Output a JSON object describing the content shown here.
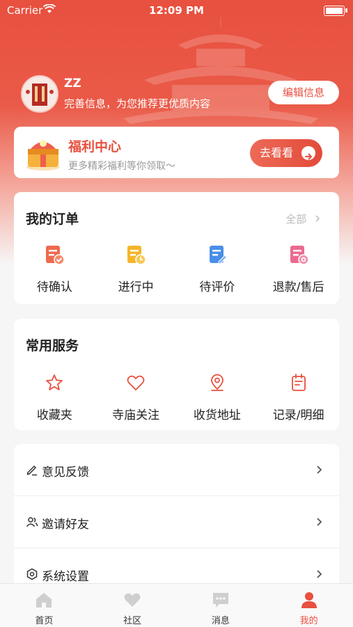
{
  "status_bar": {
    "carrier": "Carrier",
    "time": "12:09 PM"
  },
  "profile": {
    "username": "ZZ",
    "subtitle": "完善信息，为您推荐更优质内容",
    "edit_button": "编辑信息"
  },
  "welfare": {
    "title": "福利中心",
    "desc": "更多精彩福利等你领取～",
    "go_button": "去看看"
  },
  "orders": {
    "title": "我的订单",
    "all_label": "全部",
    "items": [
      {
        "label": "待确认",
        "icon": "pending-confirm-icon"
      },
      {
        "label": "进行中",
        "icon": "in-progress-icon"
      },
      {
        "label": "待评价",
        "icon": "to-review-icon"
      },
      {
        "label": "退款/售后",
        "icon": "refund-icon"
      }
    ]
  },
  "services": {
    "title": "常用服务",
    "items": [
      {
        "label": "收藏夹",
        "icon": "star-icon"
      },
      {
        "label": "寺庙关注",
        "icon": "heart-icon"
      },
      {
        "label": "收货地址",
        "icon": "location-icon"
      },
      {
        "label": "记录/明细",
        "icon": "record-icon"
      }
    ]
  },
  "menu": [
    {
      "label": "意见反馈",
      "icon": "pencil-icon"
    },
    {
      "label": "邀请好友",
      "icon": "users-icon"
    },
    {
      "label": "系统设置",
      "icon": "settings-icon"
    }
  ],
  "tabbar": [
    {
      "label": "首页",
      "icon": "home-icon"
    },
    {
      "label": "社区",
      "icon": "heart-icon"
    },
    {
      "label": "消息",
      "icon": "message-icon"
    },
    {
      "label": "我的",
      "icon": "user-icon",
      "active": true
    }
  ],
  "colors": {
    "brand": "#e8503f",
    "inactive_tab": "#cfcfcf"
  }
}
